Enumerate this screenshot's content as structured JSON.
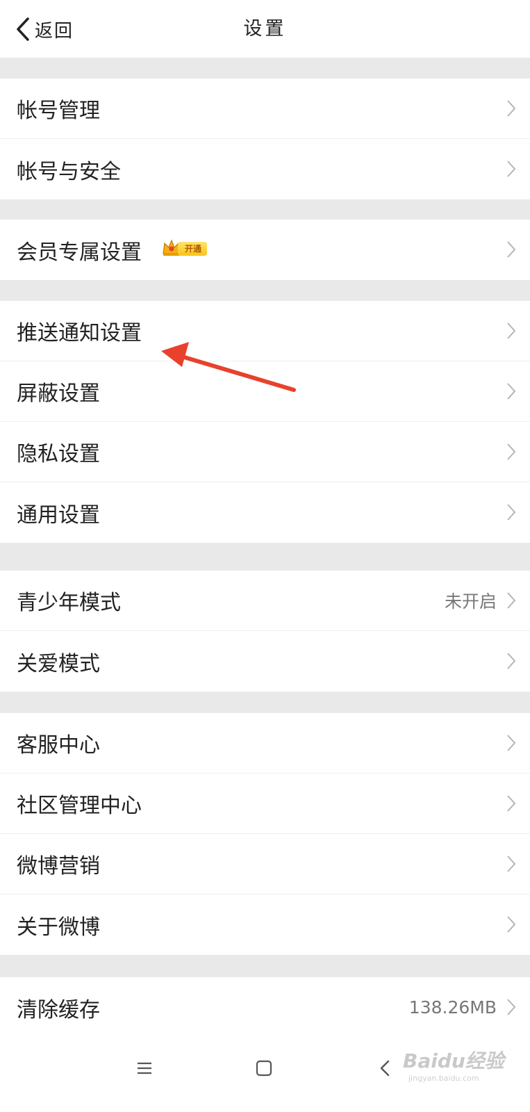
{
  "header": {
    "back_label": "返回",
    "title": "设置"
  },
  "groups": [
    {
      "items": [
        {
          "label": "帐号管理"
        },
        {
          "label": "帐号与安全"
        }
      ]
    },
    {
      "items": [
        {
          "label": "会员专属设置",
          "badge": "开通"
        }
      ]
    },
    {
      "items": [
        {
          "label": "推送通知设置"
        },
        {
          "label": "屏蔽设置"
        },
        {
          "label": "隐私设置"
        },
        {
          "label": "通用设置"
        }
      ]
    },
    {
      "items": [
        {
          "label": "青少年模式",
          "value": "未开启"
        },
        {
          "label": "关爱模式"
        }
      ]
    },
    {
      "items": [
        {
          "label": "客服中心"
        },
        {
          "label": "社区管理中心"
        },
        {
          "label": "微博营销"
        },
        {
          "label": "关于微博"
        }
      ]
    },
    {
      "items": [
        {
          "label": "清除缓存",
          "value": "138.26MB"
        }
      ]
    }
  ],
  "navbar": {
    "icons": [
      "menu-icon",
      "home-square-icon",
      "back-triangle-icon"
    ]
  },
  "watermark": {
    "text": "Baidu经验",
    "sub": "jingyan.baidu.com"
  },
  "colors": {
    "background": "#e9e9e9",
    "row": "#ffffff",
    "arrow": "#e8412c",
    "badge": "#f7c518"
  }
}
